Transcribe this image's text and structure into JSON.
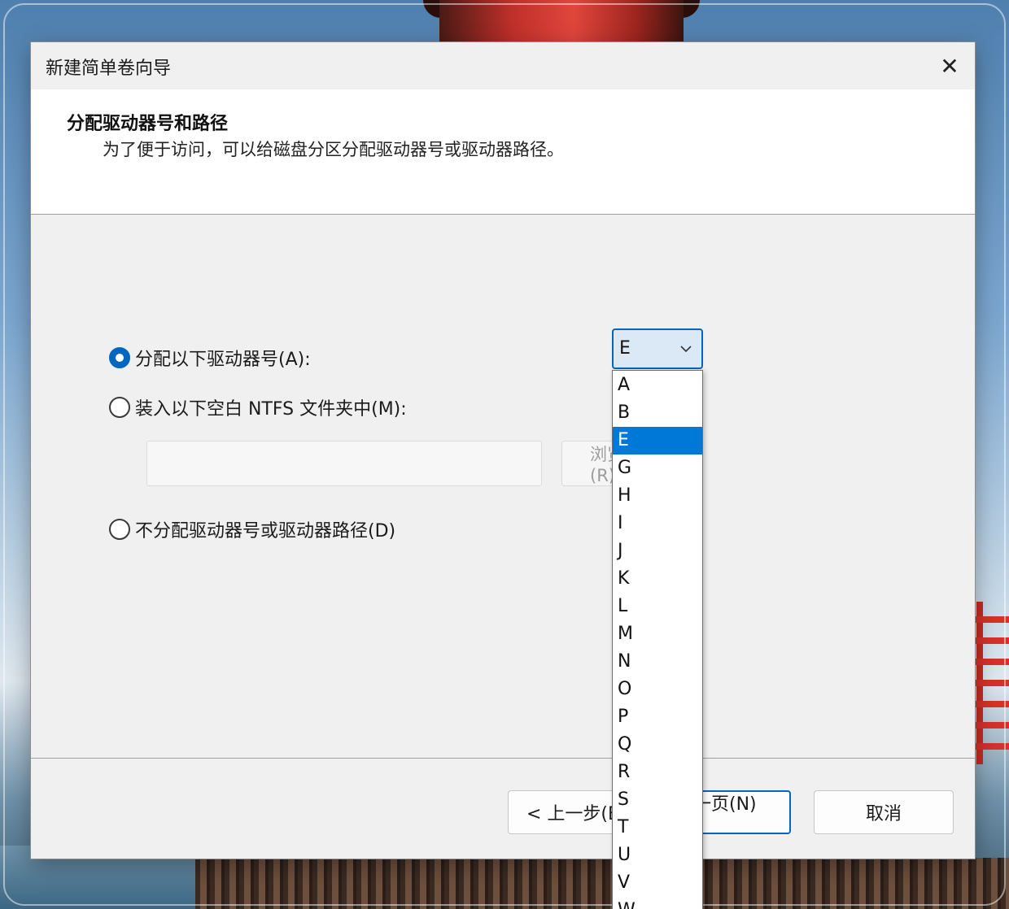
{
  "window": {
    "title": "新建简单卷向导",
    "close_glyph": "✕"
  },
  "header": {
    "title": "分配驱动器号和路径",
    "description": "为了便于访问，可以给磁盘分区分配驱动器号或驱动器路径。"
  },
  "options": {
    "assign_letter": {
      "label": "分配以下驱动器号(A):",
      "selected": true
    },
    "mount_folder": {
      "label": "装入以下空白 NTFS 文件夹中(M):",
      "selected": false
    },
    "no_assign": {
      "label": "不分配驱动器号或驱动器路径(D)",
      "selected": false
    }
  },
  "folder_path": {
    "value": ""
  },
  "browse_button": {
    "label": "浏览(R)..."
  },
  "drive_letter_combo": {
    "selected": "E",
    "options": [
      "A",
      "B",
      "E",
      "G",
      "H",
      "I",
      "J",
      "K",
      "L",
      "M",
      "N",
      "O",
      "P",
      "Q",
      "R",
      "S",
      "T",
      "U",
      "V",
      "W"
    ]
  },
  "footer": {
    "back_label": "< 上一步(B)",
    "next_label": "下一页(N) >",
    "cancel_label": "取消"
  },
  "colors": {
    "accent": "#0067c0",
    "selection": "#0078d7"
  }
}
